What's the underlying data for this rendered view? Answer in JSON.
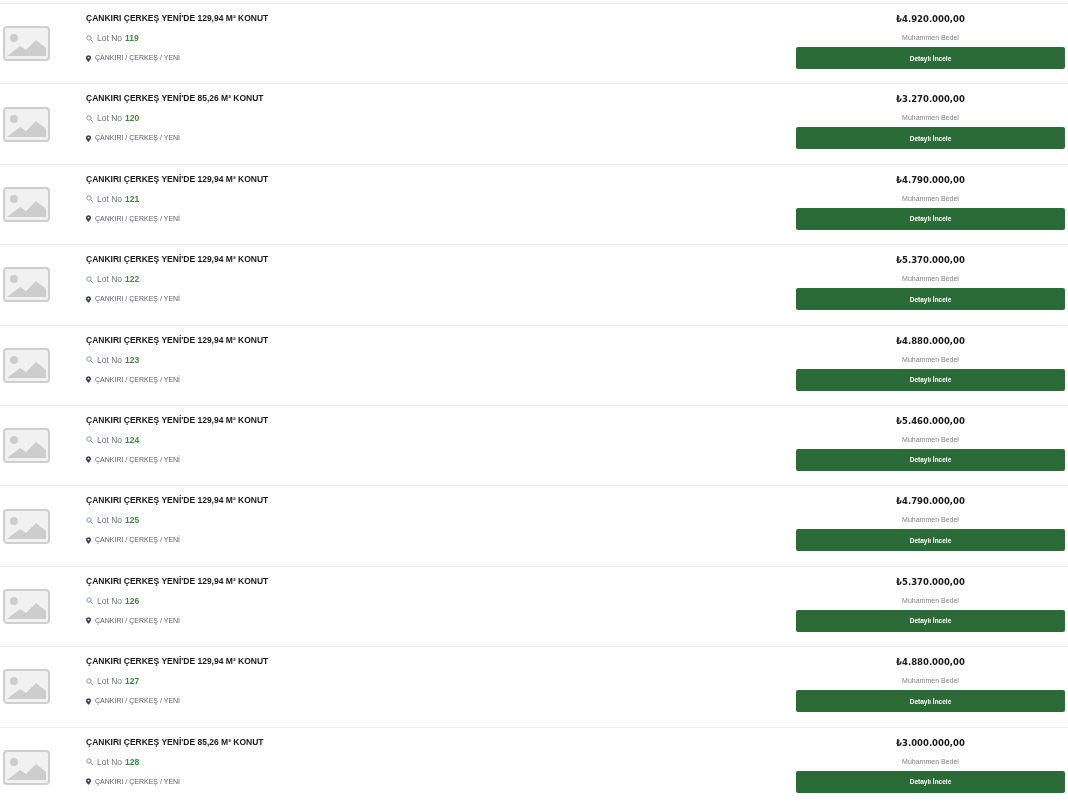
{
  "listings": [
    {
      "title": "ÇANKIRI ÇERKEŞ YENİ'DE 129,94 M² KONUT",
      "lot_label": "Lot No",
      "lot_number": "119",
      "location": "ÇANKIRI / ÇERKEŞ / YENİ",
      "price": "₺4.920.000,00",
      "price_label": "Muhammen Bedel",
      "button": "Detaylı İncele"
    },
    {
      "title": "ÇANKIRI ÇERKEŞ YENİ'DE 85,26 M² KONUT",
      "lot_label": "Lot No",
      "lot_number": "120",
      "location": "ÇANKIRI / ÇERKEŞ / YENİ",
      "price": "₺3.270.000,00",
      "price_label": "Muhammen Bedel",
      "button": "Detaylı İncele"
    },
    {
      "title": "ÇANKIRI ÇERKEŞ YENİ'DE 129,94 M² KONUT",
      "lot_label": "Lot No",
      "lot_number": "121",
      "location": "ÇANKIRI / ÇERKEŞ / YENİ",
      "price": "₺4.790.000,00",
      "price_label": "Muhammen Bedel",
      "button": "Detaylı İncele"
    },
    {
      "title": "ÇANKIRI ÇERKEŞ YENİ'DE 129,94 M² KONUT",
      "lot_label": "Lot No",
      "lot_number": "122",
      "location": "ÇANKIRI / ÇERKEŞ / YENİ",
      "price": "₺5.370.000,00",
      "price_label": "Muhammen Bedel",
      "button": "Detaylı İncele"
    },
    {
      "title": "ÇANKIRI ÇERKEŞ YENİ'DE 129,94 M² KONUT",
      "lot_label": "Lot No",
      "lot_number": "123",
      "location": "ÇANKIRI / ÇERKEŞ / YENİ",
      "price": "₺4.880.000,00",
      "price_label": "Muhammen Bedel",
      "button": "Detaylı İncele"
    },
    {
      "title": "ÇANKIRI ÇERKEŞ YENİ'DE 129,94 M² KONUT",
      "lot_label": "Lot No",
      "lot_number": "124",
      "location": "ÇANKIRI / ÇERKEŞ / YENİ",
      "price": "₺5.460.000,00",
      "price_label": "Muhammen Bedel",
      "button": "Detaylı İncele"
    },
    {
      "title": "ÇANKIRI ÇERKEŞ YENİ'DE 129,94 M² KONUT",
      "lot_label": "Lot No",
      "lot_number": "125",
      "location": "ÇANKIRI / ÇERKEŞ / YENİ",
      "price": "₺4.790.000,00",
      "price_label": "Muhammen Bedel",
      "button": "Detaylı İncele"
    },
    {
      "title": "ÇANKIRI ÇERKEŞ YENİ'DE 129,94 M² KONUT",
      "lot_label": "Lot No",
      "lot_number": "126",
      "location": "ÇANKIRI / ÇERKEŞ / YENİ",
      "price": "₺5.370.000,00",
      "price_label": "Muhammen Bedel",
      "button": "Detaylı İncele"
    },
    {
      "title": "ÇANKIRI ÇERKEŞ YENİ'DE 129,94 M² KONUT",
      "lot_label": "Lot No",
      "lot_number": "127",
      "location": "ÇANKIRI / ÇERKEŞ / YENİ",
      "price": "₺4.880.000,00",
      "price_label": "Muhammen Bedel",
      "button": "Detaylı İncele"
    },
    {
      "title": "ÇANKIRI ÇERKEŞ YENİ'DE 85,26 M² KONUT",
      "lot_label": "Lot No",
      "lot_number": "128",
      "location": "ÇANKIRI / ÇERKEŞ / YENİ",
      "price": "₺3.000.000,00",
      "price_label": "Muhammen Bedel",
      "button": "Detaylı İncele"
    }
  ]
}
